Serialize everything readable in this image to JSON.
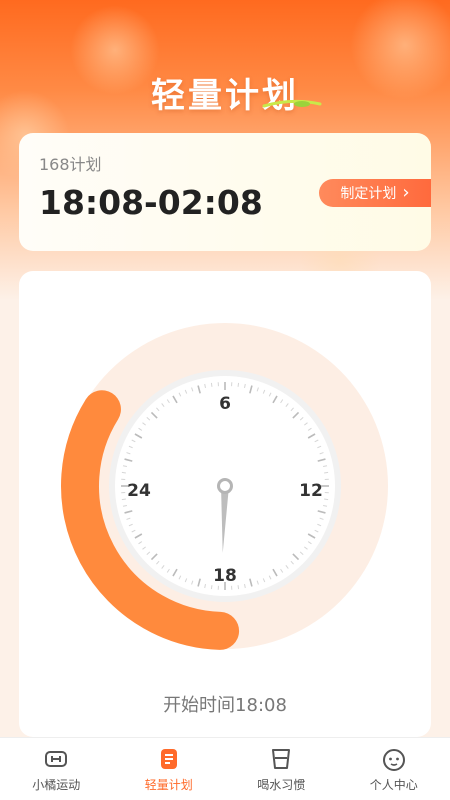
{
  "header": {
    "title": "轻量计划"
  },
  "plan_card": {
    "plan_name": "168计划",
    "time_range": "18:08-02:08",
    "make_plan_label": "制定计划",
    "make_plan_chevron": "›"
  },
  "clock": {
    "labels": {
      "top": "6",
      "right": "12",
      "bottom": "18",
      "left": "24"
    },
    "progress_start_hour": 18.13,
    "progress_end_hour": 2.13,
    "hand_hour": 18.13,
    "ring_color": "#ff8a3d",
    "start_label": "开始时间18:08"
  },
  "tabbar": {
    "items": [
      {
        "label": "小橘运动",
        "icon": "sport-icon",
        "active": false
      },
      {
        "label": "轻量计划",
        "icon": "plan-icon",
        "active": true
      },
      {
        "label": "喝水习惯",
        "icon": "cup-icon",
        "active": false
      },
      {
        "label": "个人中心",
        "icon": "face-icon",
        "active": false
      }
    ]
  },
  "colors": {
    "accent": "#ff6a2a",
    "inactive": "#555555"
  }
}
